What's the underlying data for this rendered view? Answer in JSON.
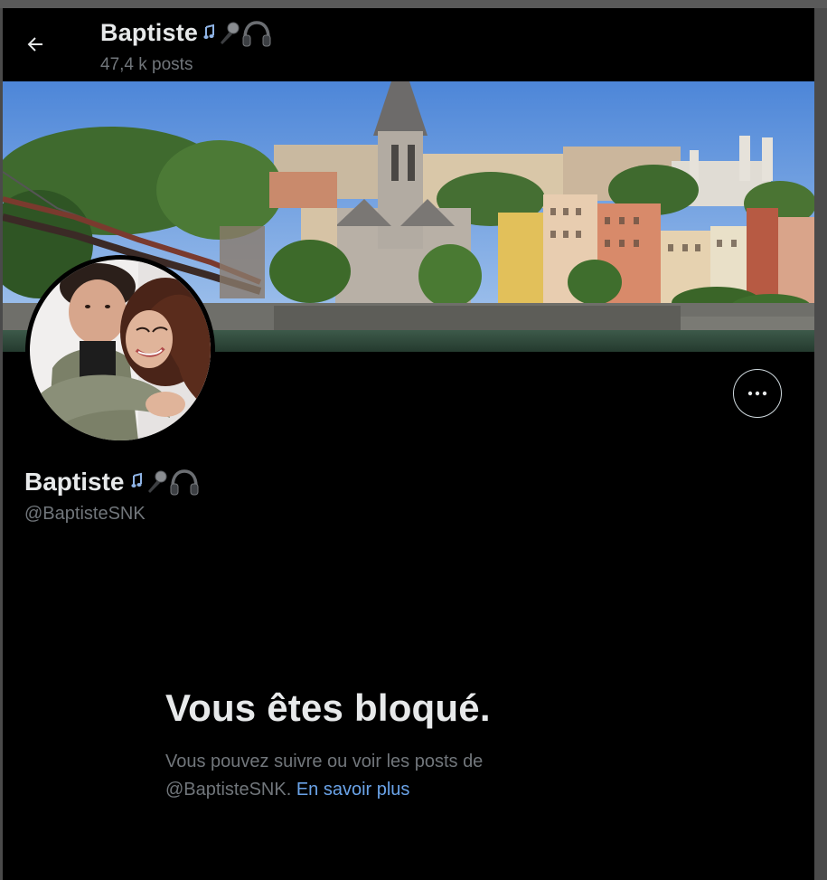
{
  "header": {
    "name": "Baptiste",
    "posts_count": "47,4 k posts"
  },
  "profile": {
    "name": "Baptiste",
    "handle": "@BaptisteSNK",
    "emojis": [
      "music-notes-icon",
      "microphone-icon",
      "headphones-icon"
    ]
  },
  "blocked": {
    "title": "Vous êtes bloqué.",
    "message_line1": "Vous pouvez suivre ou voir les posts de",
    "message_handle": "@BaptisteSNK.",
    "learn_more": "En savoir plus"
  },
  "colors": {
    "background": "#000000",
    "primary_text": "#e7e9ea",
    "secondary_text": "#71767b",
    "link": "#6aa3e8"
  }
}
